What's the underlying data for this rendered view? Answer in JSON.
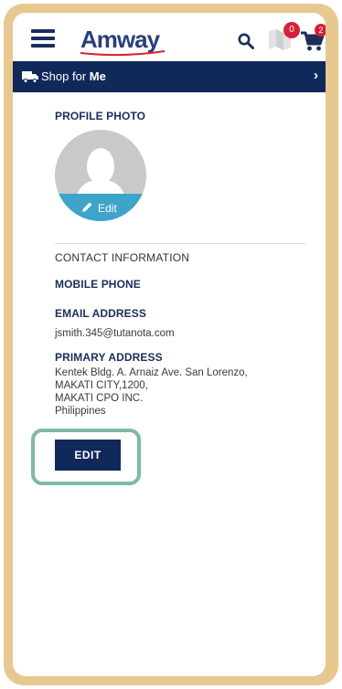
{
  "header": {
    "logo_text": "Amway",
    "flag_count": "0",
    "cart_count": "2"
  },
  "shop_bar": {
    "prefix": "Shop for ",
    "target": "Me",
    "chevron": "›"
  },
  "profile": {
    "photo_label": "PROFILE PHOTO",
    "photo_edit_label": "Edit"
  },
  "contact": {
    "section_title": "CONTACT INFORMATION",
    "mobile_label": "MOBILE PHONE",
    "email_label": "EMAIL ADDRESS",
    "email_value": "jsmith.345@tutanota.com",
    "address_label": "PRIMARY ADDRESS",
    "address_lines": [
      "Kentek Bldg. A. Arnaiz Ave. San Lorenzo,",
      "MAKATI CITY,1200,",
      "MAKATI CPO INC.",
      "Philippines"
    ]
  },
  "actions": {
    "edit_label": "EDIT"
  },
  "colors": {
    "brand_navy": "#11285a",
    "photo_edit_band": "#3ea4c9",
    "badge_red": "#d7203a",
    "highlight_green": "#7fb9a5",
    "frame_tan": "#e8c891"
  },
  "icons": [
    "menu-icon",
    "search-icon",
    "flag-icon",
    "cart-icon",
    "truck-icon",
    "chevron-right-icon",
    "pencil-icon",
    "avatar-silhouette-icon"
  ]
}
